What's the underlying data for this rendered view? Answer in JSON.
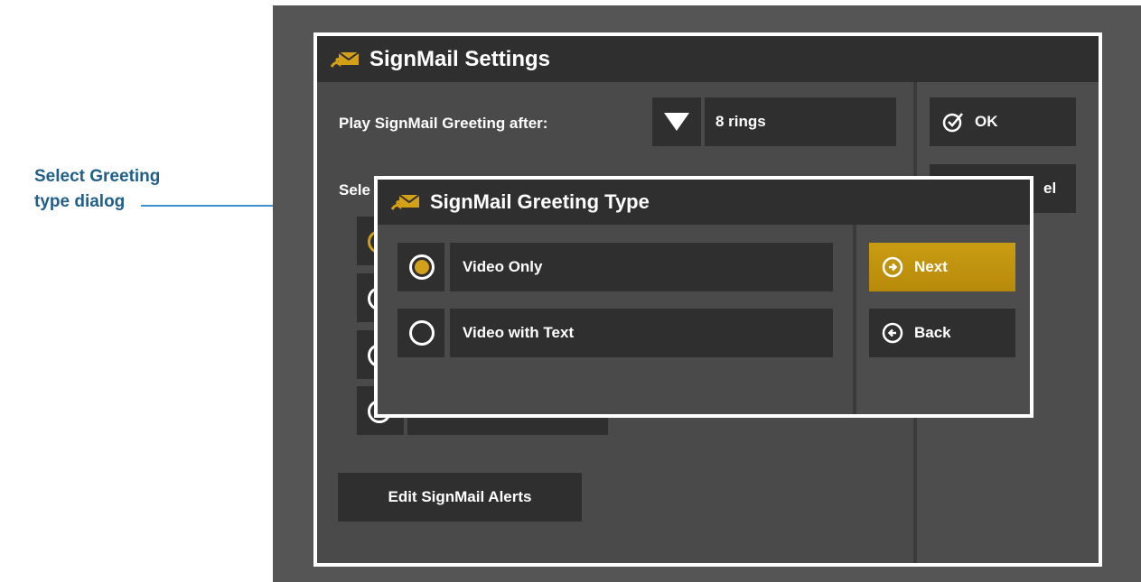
{
  "callout": {
    "line1": "Select Greeting",
    "line2": "type dialog"
  },
  "settings": {
    "title": "SignMail Settings",
    "play_after_label": "Play SignMail Greeting after:",
    "rings_value": "8 rings",
    "select_label_partial": "Sele",
    "ok_label": "OK",
    "cancel_label_partial": "el",
    "edit_alerts_label": "Edit SignMail Alerts"
  },
  "dialog": {
    "title": "SignMail Greeting Type",
    "options": [
      {
        "label": "Video Only",
        "selected": true
      },
      {
        "label": "Video with Text",
        "selected": false
      }
    ],
    "next_label": "Next",
    "back_label": "Back"
  },
  "colors": {
    "accent": "#d4a017",
    "titlebar": "#2f2f2f",
    "panel": "#4a4a4a",
    "callout_text": "#1f5f8a",
    "callout_arrow": "#3b8fd4"
  },
  "icons": {
    "title_icon": "signmail-envelope-icon",
    "ok_icon": "check-circle-icon",
    "next_icon": "arrow-right-circle-icon",
    "back_icon": "arrow-left-circle-icon",
    "dropdown_icon": "triangle-down-icon"
  }
}
